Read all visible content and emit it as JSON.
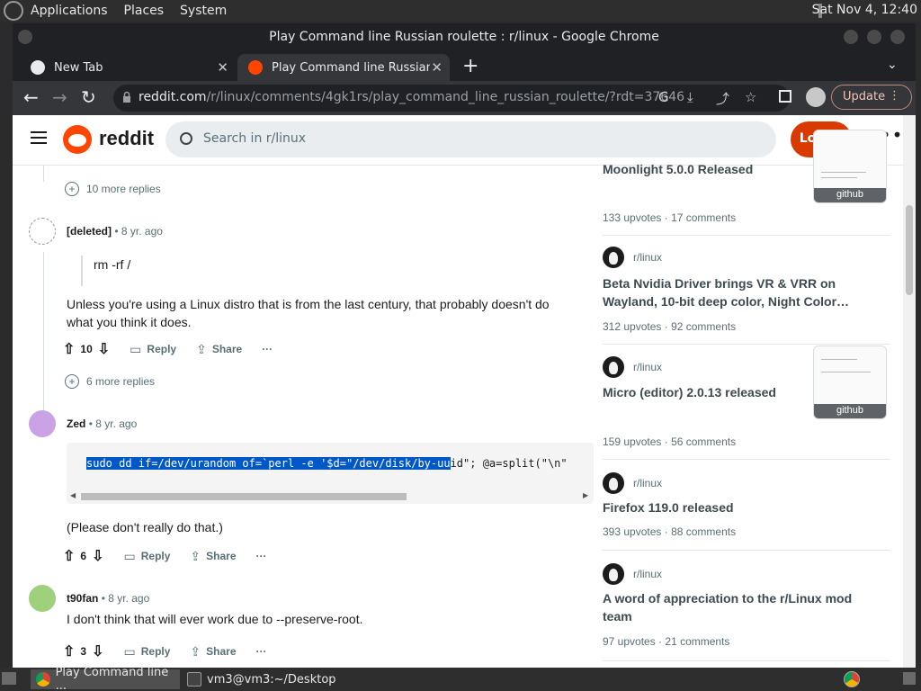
{
  "topbar": {
    "menus": [
      "Applications",
      "Places",
      "System"
    ],
    "clock": "Sat Nov 4, 12:40"
  },
  "window": {
    "title": "Play Command line Russian roulette : r/linux - Google Chrome"
  },
  "tabs": [
    {
      "label": "New Tab",
      "active": false
    },
    {
      "label": "Play Command line Russian ro",
      "active": true
    }
  ],
  "toolbar": {
    "url_host": "reddit.com",
    "url_path": "/r/linux/comments/4gk1rs/play_command_line_russian_roulette/?rdt=37646",
    "update_label": "Update"
  },
  "reddit": {
    "logo_text": "reddit",
    "search_placeholder": "Search in r/linux",
    "login_label": "Log In"
  },
  "comments": {
    "more_replies_1": "10 more replies",
    "more_replies_2": "6 more replies",
    "items": [
      {
        "author": "[deleted]",
        "time": "8 yr. ago",
        "quote": "rm -rf /",
        "text": "Unless you're using a Linux distro that is from the last century, that probably doesn't do what you think it does.",
        "votes": "10",
        "reply": "Reply",
        "share": "Share"
      },
      {
        "author": "Zed",
        "time": "8 yr. ago",
        "code_selected": "sudo dd if=/dev/urandom of=`perl -e '$d=\"/dev/disk/by-uu",
        "code_rest": "id\"; @a=split(\"\\n\"",
        "text": "(Please don't really do that.)",
        "votes": "6",
        "reply": "Reply",
        "share": "Share"
      },
      {
        "author": "t90fan",
        "time": "8 yr. ago",
        "text": "I don't think that will ever work due to --preserve-root.",
        "votes": "3",
        "reply": "Reply",
        "share": "Share"
      }
    ]
  },
  "sidebar": {
    "posts": [
      {
        "title": "Moonlight 5.0.0 Released",
        "upvotes": "133 upvotes",
        "comments": "17 comments",
        "thumb": "github"
      },
      {
        "sub": "r/linux",
        "title": "Beta Nvidia Driver brings VR & VRR on Wayland, 10-bit deep color, Night Color…",
        "upvotes": "312 upvotes",
        "comments": "92 comments"
      },
      {
        "sub": "r/linux",
        "title": "Micro (editor) 2.0.13 released",
        "upvotes": "159 upvotes",
        "comments": "56 comments",
        "thumb": "github"
      },
      {
        "sub": "r/linux",
        "title": "Firefox 119.0 released",
        "upvotes": "393 upvotes",
        "comments": "88 comments"
      },
      {
        "sub": "r/linux",
        "title": "A word of appreciation to the r/Linux mod team",
        "upvotes": "97 upvotes",
        "comments": "21 comments"
      }
    ]
  },
  "taskbar": {
    "items": [
      "Play Command line ...",
      "vm3@vm3:~/Desktop"
    ]
  },
  "colors": {
    "reddit_orange": "#ff4500",
    "login_button": "#d93a00",
    "selection": "#0057c8"
  }
}
